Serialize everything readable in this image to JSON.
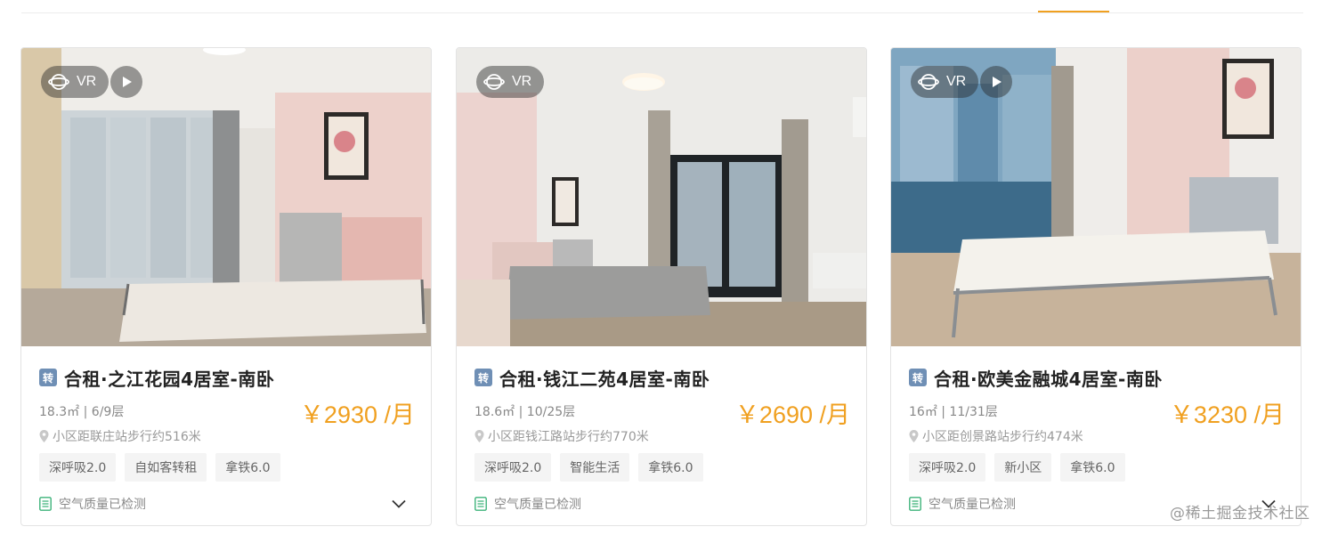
{
  "listings": [
    {
      "vr_label": "VR",
      "tag_char": "转",
      "title": "合租·之江花园4居室-南卧",
      "meta": "18.3㎡ | 6/9层",
      "price": "￥2930 /月",
      "distance": "小区距联庄站步行约516米",
      "chips": [
        "深呼吸2.0",
        "自如客转租",
        "拿铁6.0"
      ],
      "air": "空气质量已检测"
    },
    {
      "vr_label": "VR",
      "tag_char": "转",
      "title": "合租·钱江二苑4居室-南卧",
      "meta": "18.6㎡ | 10/25层",
      "price": "￥2690 /月",
      "distance": "小区距钱江路站步行约770米",
      "chips": [
        "深呼吸2.0",
        "智能生活",
        "拿铁6.0"
      ],
      "air": "空气质量已检测"
    },
    {
      "vr_label": "VR",
      "tag_char": "转",
      "title": "合租·欧美金融城4居室-南卧",
      "meta": "16㎡ | 11/31层",
      "price": "￥3230 /月",
      "distance": "小区距创景路站步行约474米",
      "chips": [
        "深呼吸2.0",
        "新小区",
        "拿铁6.0"
      ],
      "air": "空气质量已检测"
    }
  ],
  "colors": {
    "accent": "#f0a020",
    "tag_blue": "#6f8fb5",
    "chip_bg": "#f4f4f4",
    "air_green": "#3db37a"
  },
  "icons": [
    "vr-icon",
    "play-icon",
    "location-pin-icon",
    "air-quality-icon",
    "chevron-down-icon"
  ],
  "watermark": "@稀土掘金技术社区"
}
